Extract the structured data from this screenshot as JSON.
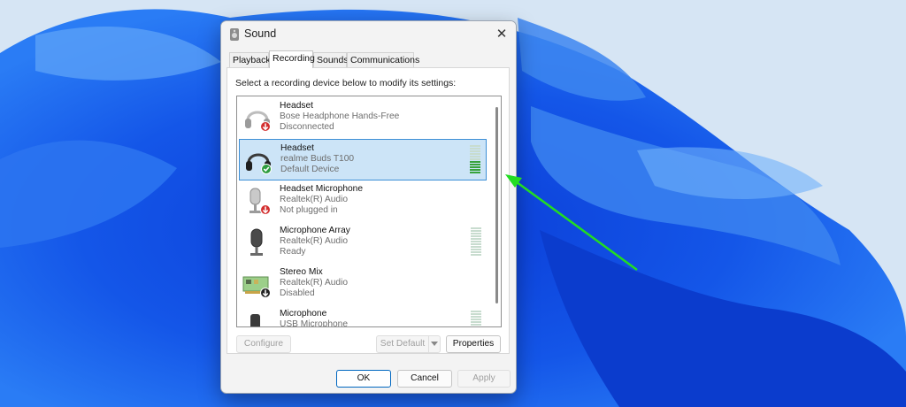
{
  "window": {
    "title": "Sound",
    "close_glyph": "✕"
  },
  "tabs": [
    {
      "label": "Playback",
      "active": false
    },
    {
      "label": "Recording",
      "active": true
    },
    {
      "label": "Sounds",
      "active": false
    },
    {
      "label": "Communications",
      "active": false
    }
  ],
  "instruction": "Select a recording device below to modify its settings:",
  "devices": [
    {
      "name": "Headset",
      "driver": "Bose Headphone Hands-Free",
      "status": "Disconnected",
      "icon": "headset-icon",
      "badge": "red-down-arrow",
      "selected": false,
      "meter": false
    },
    {
      "name": "Headset",
      "driver": "realme Buds T100",
      "status": "Default Device",
      "icon": "headset-icon",
      "badge": "green-check",
      "selected": true,
      "meter": true,
      "meter_level": 0.45
    },
    {
      "name": "Headset Microphone",
      "driver": "Realtek(R) Audio",
      "status": "Not plugged in",
      "icon": "microphone-icon",
      "badge": "red-down-arrow",
      "selected": false,
      "meter": false
    },
    {
      "name": "Microphone Array",
      "driver": "Realtek(R) Audio",
      "status": "Ready",
      "icon": "microphone-icon",
      "badge": "none",
      "selected": false,
      "meter": true,
      "meter_level": 0
    },
    {
      "name": "Stereo Mix",
      "driver": "Realtek(R) Audio",
      "status": "Disabled",
      "icon": "sound-card-icon",
      "badge": "black-down-arrow",
      "selected": false,
      "meter": false
    },
    {
      "name": "Microphone",
      "driver": "USB Microphone",
      "status": "",
      "icon": "microphone-icon",
      "badge": "none",
      "selected": false,
      "meter": true,
      "meter_level": 0
    }
  ],
  "buttons": {
    "configure": "Configure",
    "set_default": "Set Default",
    "properties": "Properties",
    "ok": "OK",
    "cancel": "Cancel",
    "apply": "Apply"
  },
  "colors": {
    "accent": "#0067c0",
    "selection": "#cce4f7",
    "meter_active": "#37a33c",
    "annotation_arrow": "#22dd22"
  }
}
